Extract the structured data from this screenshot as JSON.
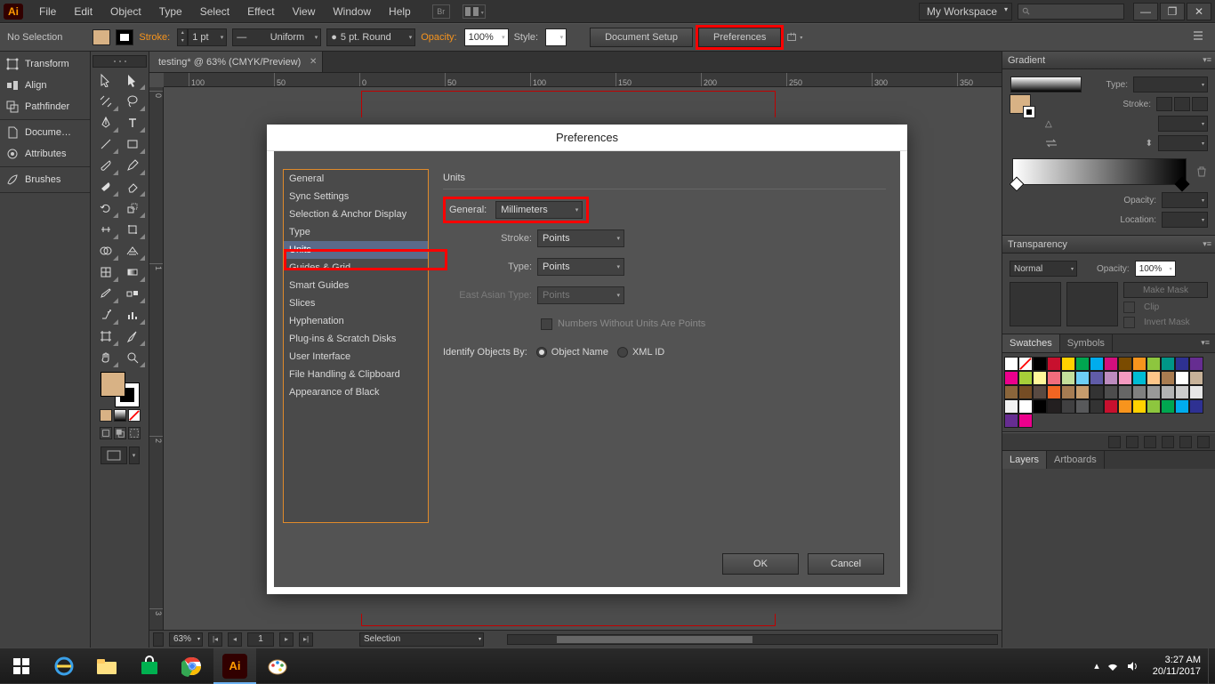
{
  "app": {
    "logo": "Ai"
  },
  "menubar": {
    "items": [
      "File",
      "Edit",
      "Object",
      "Type",
      "Select",
      "Effect",
      "View",
      "Window",
      "Help"
    ],
    "workspace": "My Workspace"
  },
  "optbar": {
    "selection": "No Selection",
    "stroke_label": "Stroke:",
    "stroke_weight": "1 pt",
    "stroke_profile": "Uniform",
    "brush": "5 pt. Round",
    "opacity_label": "Opacity:",
    "opacity": "100%",
    "style_label": "Style:",
    "doc_setup": "Document Setup",
    "preferences": "Preferences"
  },
  "left_dock": {
    "group1": [
      "Transform",
      "Align",
      "Pathfinder"
    ],
    "group2": [
      "Docume…",
      "Attributes"
    ],
    "group3": [
      "Brushes"
    ]
  },
  "doc_tab": "testing* @ 63% (CMYK/Preview)",
  "ruler_h": [
    "100",
    "50",
    "0",
    "50",
    "100",
    "150",
    "200",
    "250",
    "300",
    "350"
  ],
  "ruler_v": [
    "0",
    "1",
    "2",
    "3"
  ],
  "status": {
    "zoom": "63%",
    "page": "1",
    "tool": "Selection"
  },
  "right": {
    "gradient": {
      "title": "Gradient",
      "type_label": "Type:",
      "stroke_label": "Stroke:",
      "opacity_label": "Opacity:",
      "location_label": "Location:"
    },
    "transparency": {
      "title": "Transparency",
      "mode": "Normal",
      "opacity_label": "Opacity:",
      "opacity": "100%",
      "make_mask": "Make Mask",
      "clip": "Clip",
      "invert": "Invert Mask"
    },
    "swatches": {
      "tab1": "Swatches",
      "tab2": "Symbols"
    },
    "layers": {
      "tab1": "Layers",
      "tab2": "Artboards"
    }
  },
  "pref": {
    "title": "Preferences",
    "sidebar": [
      "General",
      "Sync Settings",
      "Selection & Anchor Display",
      "Type",
      "Units",
      "Guides & Grid",
      "Smart Guides",
      "Slices",
      "Hyphenation",
      "Plug-ins & Scratch Disks",
      "User Interface",
      "File Handling & Clipboard",
      "Appearance of Black"
    ],
    "selected_index": 4,
    "section": "Units",
    "labels": {
      "general": "General:",
      "stroke": "Stroke:",
      "type": "Type:",
      "east_asian": "East Asian Type:",
      "numbers": "Numbers Without Units Are Points",
      "identify": "Identify Objects By:",
      "obj_name": "Object Name",
      "xml_id": "XML ID"
    },
    "values": {
      "general": "Millimeters",
      "stroke": "Points",
      "type": "Points",
      "east_asian": "Points"
    },
    "buttons": {
      "ok": "OK",
      "cancel": "Cancel"
    }
  },
  "taskbar": {
    "time": "3:27 AM",
    "date": "20/11/2017"
  },
  "swatch_colors": [
    "#ffffff",
    "#ffffff",
    "#000000",
    "#c8102e",
    "#ffd100",
    "#00a650",
    "#00aced",
    "#d40f7d",
    "#7a4b00",
    "#f7941d",
    "#8dc63e",
    "#009688",
    "#2e3192",
    "#662d91",
    "#ec008c",
    "#a6ce39",
    "#fff799",
    "#f26d7d",
    "#c4df9b",
    "#6dcff6",
    "#605ca8",
    "#bd8cbf",
    "#f49ac1",
    "#00bcd4",
    "#fdc689",
    "#a97c50",
    "#ffffff",
    "#c7b299",
    "#8a653b",
    "#754c24",
    "#594a42",
    "#f26522",
    "#a67c52",
    "#c69c6d",
    "#333333",
    "#4d4d4d",
    "#666666",
    "#808080",
    "#999999",
    "#b3b3b3",
    "#cccccc",
    "#e6e6e6",
    "#f2f2f2",
    "#ffffff",
    "#000000",
    "#231f20",
    "#404041",
    "#58595b",
    "#333333",
    "#c8102e",
    "#f7941d",
    "#ffd100",
    "#8dc63e",
    "#00a650",
    "#00aced",
    "#2e3192",
    "#662d91",
    "#ec008c"
  ]
}
